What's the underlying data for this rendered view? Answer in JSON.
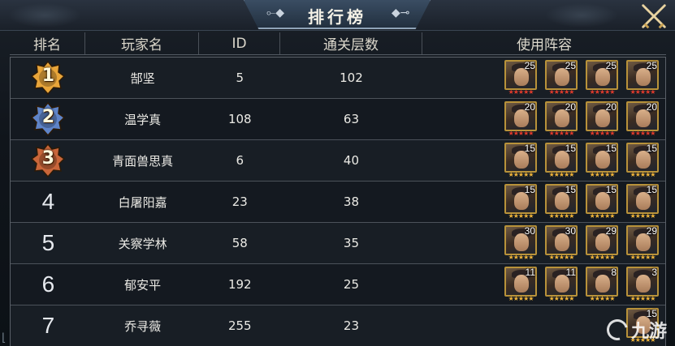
{
  "title": "排行榜",
  "columns": {
    "rank": "排名",
    "player_name": "玩家名",
    "id": "ID",
    "floors": "通关层数",
    "lineup": "使用阵容"
  },
  "rows": [
    {
      "rank": "1",
      "name": "郜坚",
      "id": "5",
      "floors": "102",
      "medal": "gold",
      "hero_levels": [
        "25",
        "25",
        "25",
        "25"
      ],
      "star_color": "red"
    },
    {
      "rank": "2",
      "name": "温学真",
      "id": "108",
      "floors": "63",
      "medal": "silver",
      "hero_levels": [
        "20",
        "20",
        "20",
        "20"
      ],
      "star_color": "red"
    },
    {
      "rank": "3",
      "name": "青面兽思真",
      "id": "6",
      "floors": "40",
      "medal": "bronze",
      "hero_levels": [
        "15",
        "15",
        "15",
        "15"
      ],
      "star_color": "gold"
    },
    {
      "rank": "4",
      "name": "白屠阳嘉",
      "id": "23",
      "floors": "38",
      "medal": "",
      "hero_levels": [
        "15",
        "15",
        "15",
        "15"
      ],
      "star_color": "gold"
    },
    {
      "rank": "5",
      "name": "关察学林",
      "id": "58",
      "floors": "35",
      "medal": "",
      "hero_levels": [
        "30",
        "30",
        "29",
        "29"
      ],
      "star_color": "gold"
    },
    {
      "rank": "6",
      "name": "郁安平",
      "id": "192",
      "floors": "25",
      "medal": "",
      "hero_levels": [
        "11",
        "11",
        "8",
        "3"
      ],
      "star_color": "gold"
    },
    {
      "rank": "7",
      "name": "乔寻薇",
      "id": "255",
      "floors": "23",
      "medal": "",
      "hero_levels": [
        "15"
      ],
      "star_color": "gold"
    }
  ],
  "watermark": "九游",
  "icons": {
    "close": "crossed-swords-close-icon",
    "medal": "rank-medal-icon",
    "hero": "hero-portrait-icon"
  },
  "colors": {
    "gold_medal": "#e8a53a",
    "silver_medal": "#5f84c8",
    "bronze_medal": "#c9663a",
    "star_red": "#e23b2b",
    "star_gold": "#f0b43a",
    "portrait_frame": "#b8923a"
  }
}
